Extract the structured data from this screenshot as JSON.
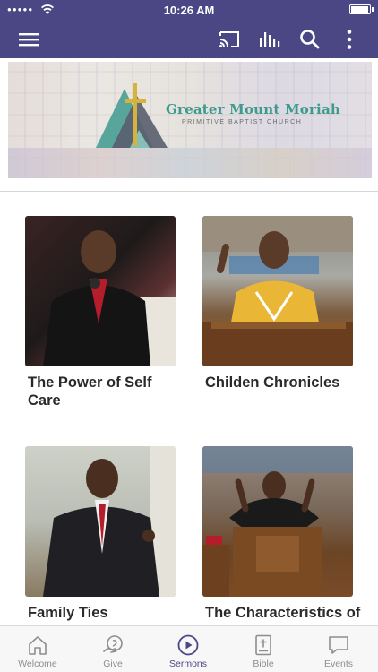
{
  "status_bar": {
    "signal": "●●●●●",
    "time": "10:26 AM"
  },
  "nav": {
    "icons": [
      "menu-icon",
      "cast-icon",
      "audio-bars-icon",
      "search-icon",
      "more-vertical-icon"
    ]
  },
  "banner": {
    "church_name": "Greater Mount Moriah",
    "church_subtitle": "PRIMITIVE BAPTIST CHURCH"
  },
  "sermons": [
    {
      "title": "The Power of Self Care"
    },
    {
      "title": "Childen Chronicles"
    },
    {
      "title": "Family Ties"
    },
    {
      "title": "The Characteristics of A Wise Man"
    }
  ],
  "tabs": [
    {
      "label": "Welcome",
      "icon": "home-icon",
      "active": false
    },
    {
      "label": "Give",
      "icon": "give-icon",
      "active": false
    },
    {
      "label": "Sermons",
      "icon": "play-circle-icon",
      "active": true
    },
    {
      "label": "Bible",
      "icon": "bible-icon",
      "active": false
    },
    {
      "label": "Events",
      "icon": "chat-bubble-icon",
      "active": false
    }
  ],
  "colors": {
    "brand": "#4a4784",
    "tab_inactive": "#8e8e8e",
    "logo_teal": "#3e9a8e"
  }
}
